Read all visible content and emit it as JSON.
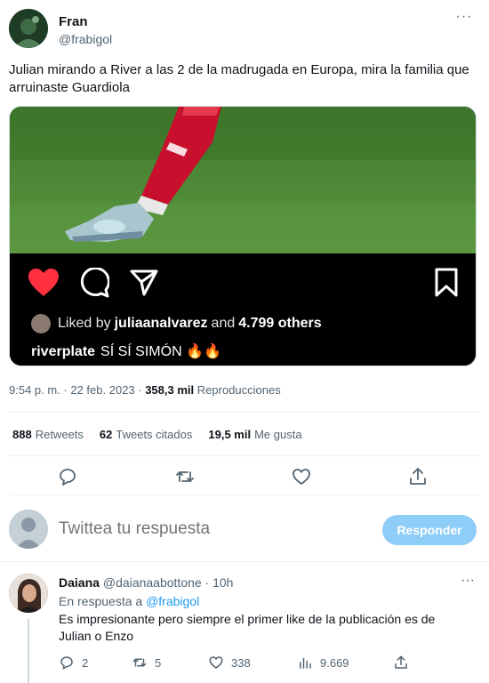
{
  "tweet": {
    "author_name": "Fran",
    "author_handle": "@frabigol",
    "more_label": "···",
    "text": "Julian mirando a River a las 2 de la madrugada en Europa, mira la familia que arruinaste Guardiola",
    "media": {
      "liked_prefix": "Liked by",
      "liked_user": "juliaanalvarez",
      "liked_middle": "and",
      "liked_others": "4.799 others",
      "caption_user": "riverplate",
      "caption_text": "SÍ SÍ SIMÓN 🔥🔥"
    },
    "time": "9:54 p. m. · 22 feb. 2023 · ",
    "views_count": "358,3 mil",
    "views_label": "Reproducciones",
    "stats": {
      "retweets_count": "888",
      "retweets_label": "Retweets",
      "quotes_count": "62",
      "quotes_label": "Tweets citados",
      "likes_count": "19,5 mil",
      "likes_label": "Me gusta"
    }
  },
  "compose": {
    "placeholder": "Twittea tu respuesta",
    "button_label": "Responder"
  },
  "reply": {
    "author_name": "Daiana",
    "author_handle_time": "@daianaabottone · 10h",
    "more_label": "···",
    "replying_prefix": "En respuesta a",
    "replying_to": "@frabigol",
    "text": "Es impresionante pero siempre el primer like de la publicación es de Julian o Enzo",
    "replies": "2",
    "retweets": "5",
    "likes": "338",
    "views": "9.669"
  },
  "colors": {
    "accent": "#1d9bf0",
    "button_disabled": "#8ecdf8",
    "secondary_text": "#536471",
    "ig_heart": "#ff3040"
  }
}
